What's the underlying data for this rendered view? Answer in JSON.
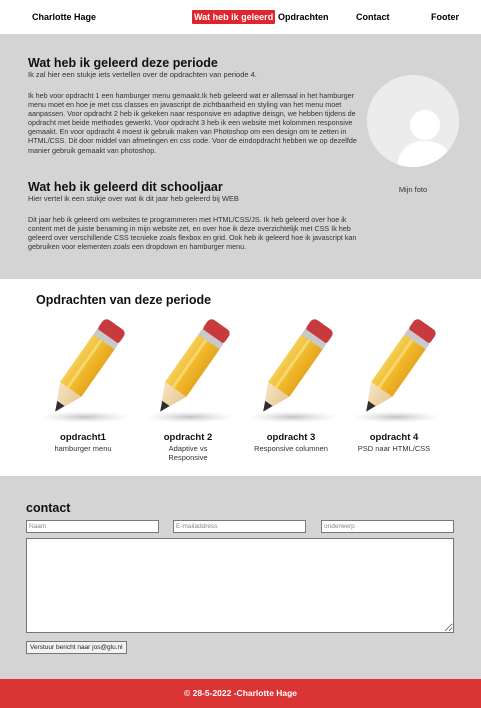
{
  "nav": {
    "brand": "Charlotte Hage",
    "items": [
      {
        "label": "Wat heb ik geleerd"
      },
      {
        "label": "Opdrachten"
      },
      {
        "label": "Contact"
      },
      {
        "label": "Footer"
      }
    ]
  },
  "learn": {
    "period": {
      "title": "Wat heb ik geleerd deze periode",
      "subtitle": "Ik zal hier een stukje iets vertellen over de opdrachten van periode 4.",
      "body": "Ik heb voor opdracht 1 een hamburger menu gemaakt.Ik heb geleerd wat er allemaal in het hamburger menu moet en hoe je met css classes en javascript de zichtbaarheid en styling van het menu moet aanpassen. Voor opdracht 2 heb ik gekeken naar responsive en adaptive deisgn, we hebben tijdens de opdracht met beide methodes gewerkt. Voor opdracht 3 heb ik een website met kolommen responsive gemaakt. En voor opdracht 4 moest ik gebruik maken van Photoshop om een design om te zetten in HTML/CSS. Dit door middel van afmetingen en css code. Voor de eindopdracht hebben we op dezelfde manier gebruik gemaakt van photoshop."
    },
    "year": {
      "title": "Wat heb ik geleerd dit schooljaar",
      "subtitle": "Hier vertel ik een stukje over wat ik dit jaar heb geleerd bij WEB",
      "body": "Dit jaar heb ik geleerd om websites te programmeren met HTML/CSS/JS. Ik heb geleerd over hoe ik content met de juiste benaming in mijn website zet, en over hoe ik deze overzichtelijk met CSS Ik heb geleerd over verschillende CSS tecnieke zoals flexbox en grid. Ook heb ik geleerd hoe ik javascript kan gebruiken voor elementen zoals een dropdown en hamburger menu."
    },
    "photo_caption": "Mijn foto"
  },
  "assignments": {
    "title": "Opdrachten van deze periode",
    "items": [
      {
        "title": "opdracht1",
        "desc": "hamburger menu"
      },
      {
        "title": "opdracht 2",
        "desc": "Adaptive vs Responsive"
      },
      {
        "title": "opdracht 3",
        "desc": "Responsive columnen"
      },
      {
        "title": "opdracht 4",
        "desc": "PSD naar HTML/CSS"
      }
    ]
  },
  "contact": {
    "title": "contact",
    "name_placeholder": "Naam",
    "email_placeholder": "E-mailaddress",
    "subject_placeholder": "onderwerp",
    "submit_label": "Verstuur bericht naar jos@glu.nl"
  },
  "footer": {
    "text": "© 28-5-2022 -Charlotte Hage"
  },
  "colors": {
    "accent": "#e0262d",
    "footer": "#da3434",
    "section_bg": "#d4d4d4"
  }
}
